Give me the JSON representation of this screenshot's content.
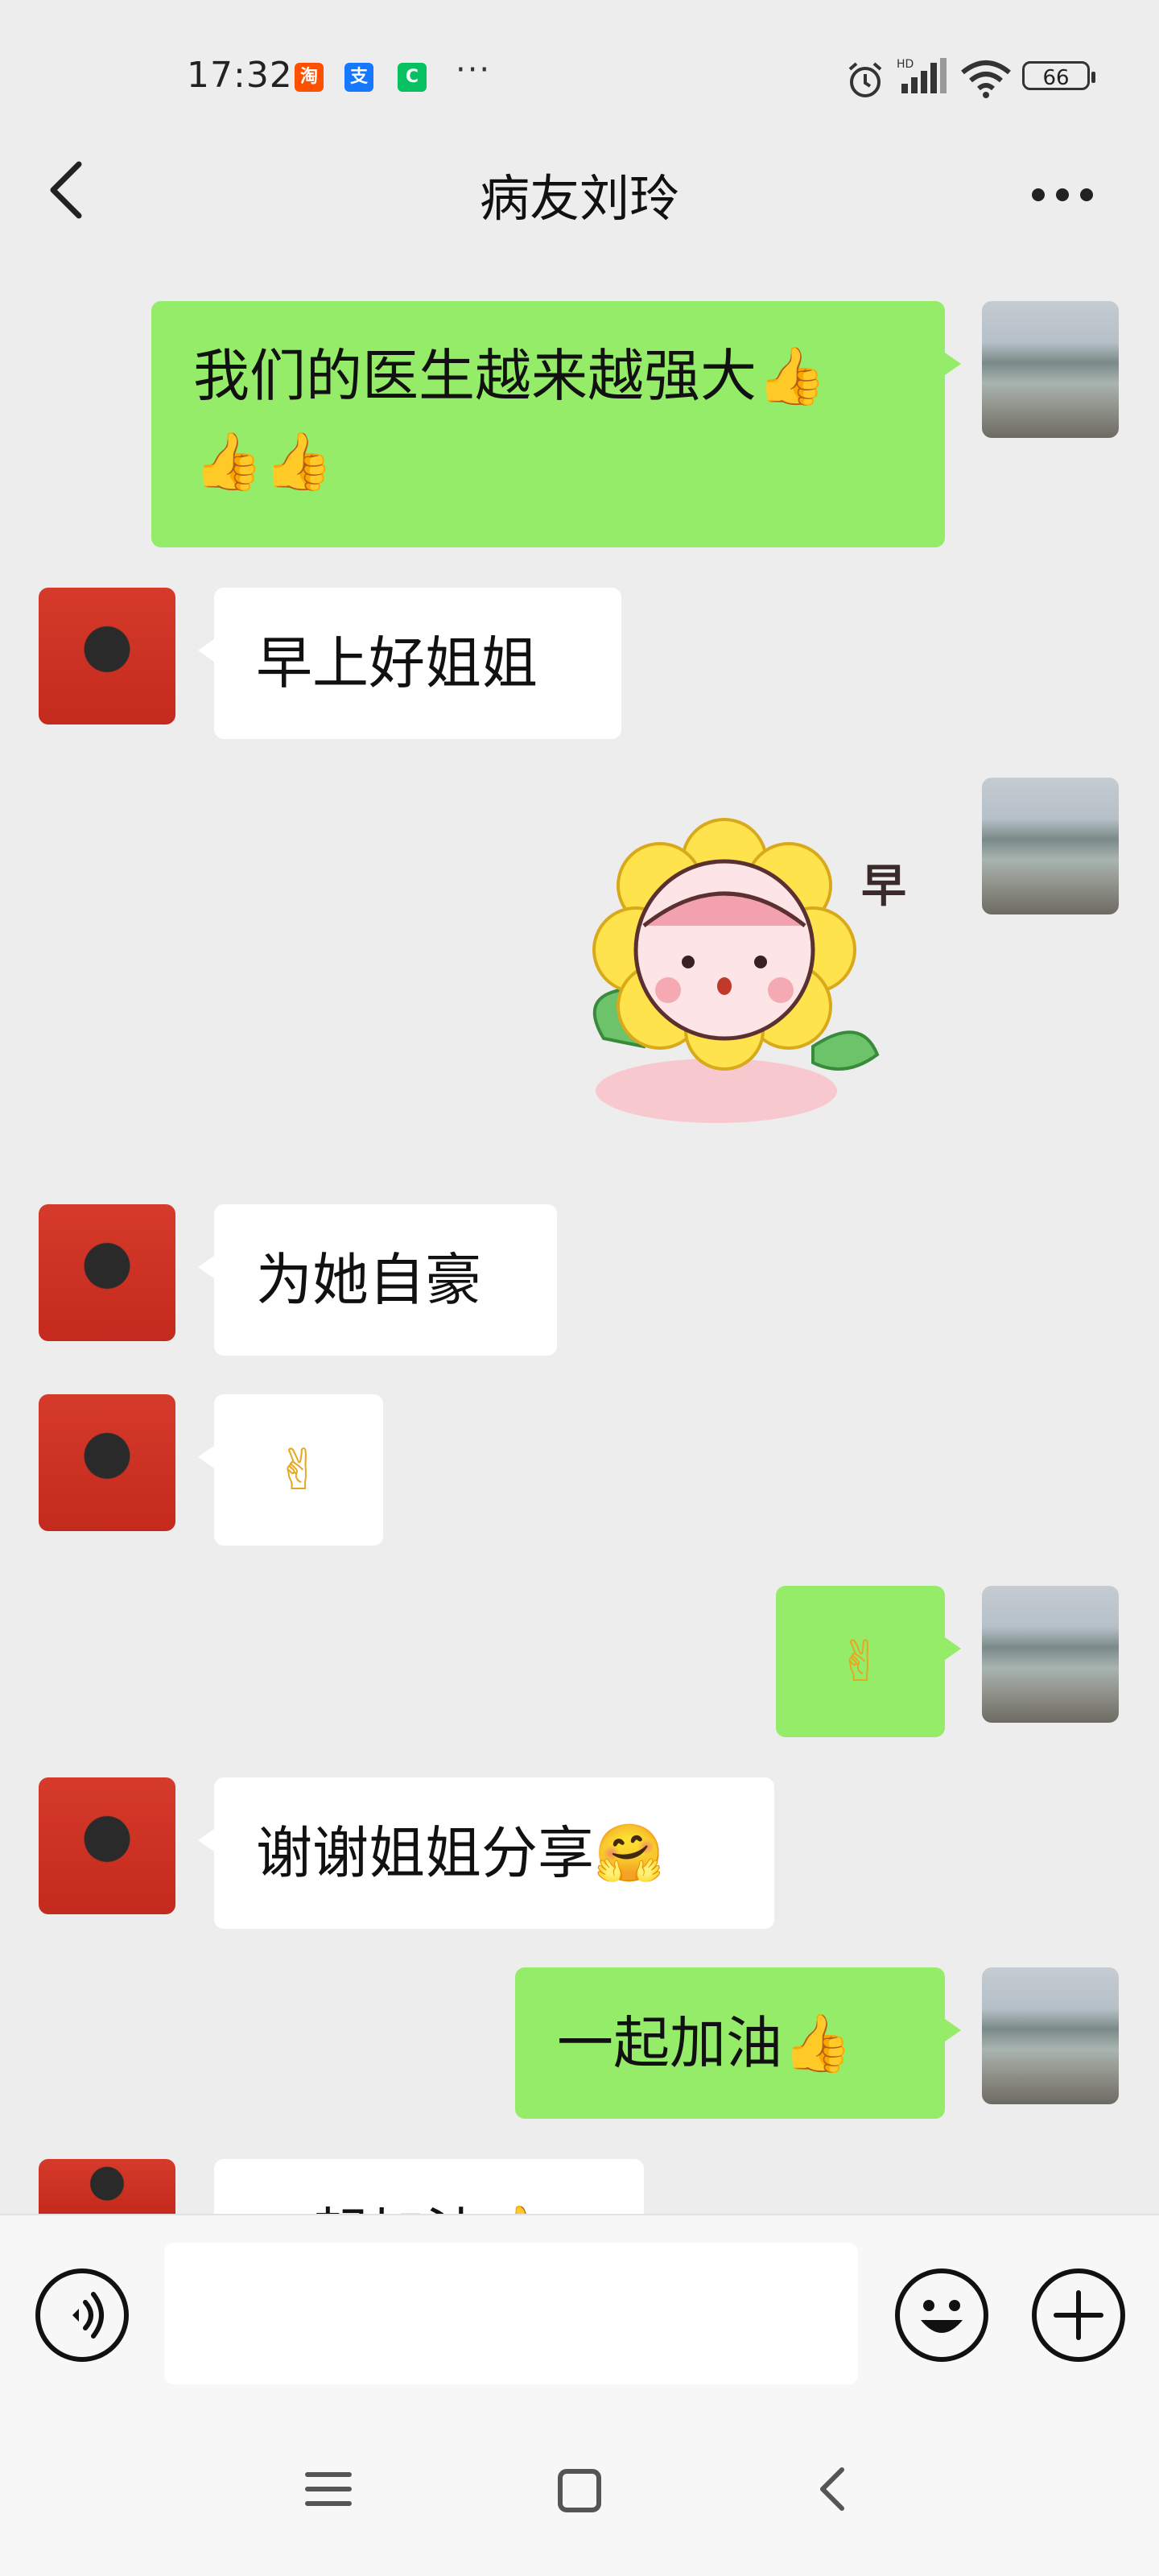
{
  "status_bar": {
    "time": "17:32",
    "app_icons": [
      {
        "name": "taobao-icon",
        "glyph": "淘",
        "color": "#ff5000"
      },
      {
        "name": "alipay-icon",
        "glyph": "支",
        "color": "#1677ff"
      },
      {
        "name": "app-green-icon",
        "glyph": "C",
        "color": "#07c160"
      }
    ],
    "more": "···",
    "signal_label": "HD",
    "battery": "66"
  },
  "header": {
    "title": "病友刘玲"
  },
  "messages": [
    {
      "side": "me",
      "text": "我们的医生越来越强大👍",
      "text2": "👍👍"
    },
    {
      "side": "other",
      "text": "早上好姐姐"
    },
    {
      "side": "me",
      "sticker": "sunflower-sticker",
      "sticker_text": "早"
    },
    {
      "side": "other",
      "text": "为她自豪"
    },
    {
      "side": "other",
      "text": "✌"
    },
    {
      "side": "me",
      "text": "✌"
    },
    {
      "side": "other",
      "text": "谢谢姐姐分享🤗"
    },
    {
      "side": "me",
      "text": "一起加油👍"
    },
    {
      "side": "other",
      "text": "一起加油👍"
    }
  ],
  "input": {
    "voice_icon": "voice-icon",
    "emoji_icon": "emoji-icon",
    "plus_icon": "plus-icon",
    "value": ""
  },
  "nav": {
    "menu_icon": "menu-icon",
    "home_icon": "home-icon",
    "back_icon": "back-icon"
  },
  "colors": {
    "bubble_me": "#95ec69",
    "bubble_other": "#ffffff",
    "background": "#ededed"
  }
}
